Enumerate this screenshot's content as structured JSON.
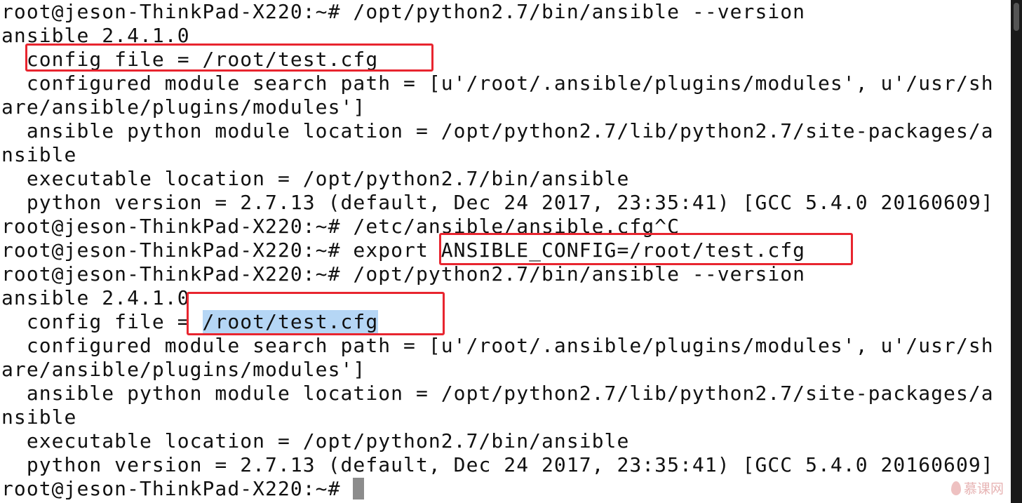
{
  "terminal": {
    "lines": [
      "root@jeson-ThinkPad-X220:~# /opt/python2.7/bin/ansible --version",
      "ansible 2.4.1.0",
      "  config file = /root/test.cfg",
      "  configured module search path = [u'/root/.ansible/plugins/modules', u'/usr/sh",
      "are/ansible/plugins/modules']",
      "  ansible python module location = /opt/python2.7/lib/python2.7/site-packages/a",
      "nsible",
      "  executable location = /opt/python2.7/bin/ansible",
      "  python version = 2.7.13 (default, Dec 24 2017, 23:35:41) [GCC 5.4.0 20160609]",
      "root@jeson-ThinkPad-X220:~# /etc/ansible/ansible.cfg^C",
      "root@jeson-ThinkPad-X220:~# export ANSIBLE_CONFIG=/root/test.cfg",
      "root@jeson-ThinkPad-X220:~# /opt/python2.7/bin/ansible --version",
      "ansible 2.4.1.0",
      "  config file = ",
      "  configured module search path = [u'/root/.ansible/plugins/modules', u'/usr/sh",
      "are/ansible/plugins/modules']",
      "  ansible python module location = /opt/python2.7/lib/python2.7/site-packages/a",
      "nsible",
      "  executable location = /opt/python2.7/bin/ansible",
      "  python version = 2.7.13 (default, Dec 24 2017, 23:35:41) [GCC 5.4.0 20160609]",
      "root@jeson-ThinkPad-X220:~# "
    ],
    "selected_text": "/root/test.cfg"
  },
  "watermark": {
    "text": "慕课网"
  },
  "colors": {
    "background": "#ffffff",
    "text": "#111111",
    "annotation_box": "#e8252f",
    "selection": "#b5d6f5",
    "scrollbar": "#1a1a1a"
  }
}
